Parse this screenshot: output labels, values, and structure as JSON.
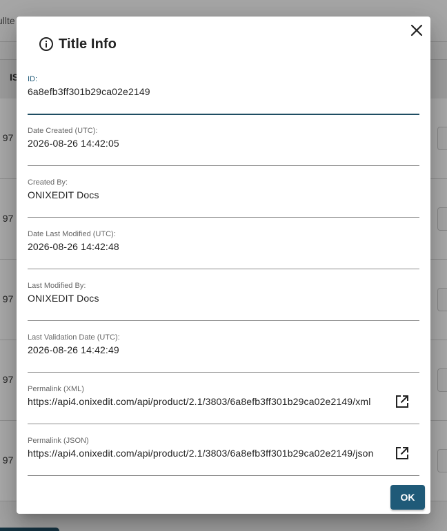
{
  "background": {
    "topbar_text": "ullte",
    "table_header_text": "IS",
    "row_fragment": ". 97"
  },
  "dialog": {
    "title": "Title Info",
    "title_icon": "info-icon",
    "close_icon": "close-icon",
    "fields": [
      {
        "label": "ID:",
        "value": "6a8efb3ff301b29ca02e2149"
      },
      {
        "label": "Date Created (UTC):",
        "value": "2026-08-26 14:42:05"
      },
      {
        "label": "Created By:",
        "value": "ONIXEDIT Docs"
      },
      {
        "label": "Date Last Modified (UTC):",
        "value": "2026-08-26 14:42:48"
      },
      {
        "label": "Last Modified By:",
        "value": "ONIXEDIT Docs"
      },
      {
        "label": "Last Validation Date (UTC):",
        "value": "2026-08-26 14:42:49"
      },
      {
        "label": "Permalink (XML)",
        "value": "https://api4.onixedit.com/api/product/2.1/3803/6a8efb3ff301b29ca02e2149/xml"
      },
      {
        "label": "Permalink (JSON)",
        "value": "https://api4.onixedit.com/api/product/2.1/3803/6a8efb3ff301b29ca02e2149/json"
      }
    ],
    "ok_label": "OK"
  },
  "colors": {
    "accent": "#1f5a78",
    "focus_underline": "#1f4d63"
  }
}
